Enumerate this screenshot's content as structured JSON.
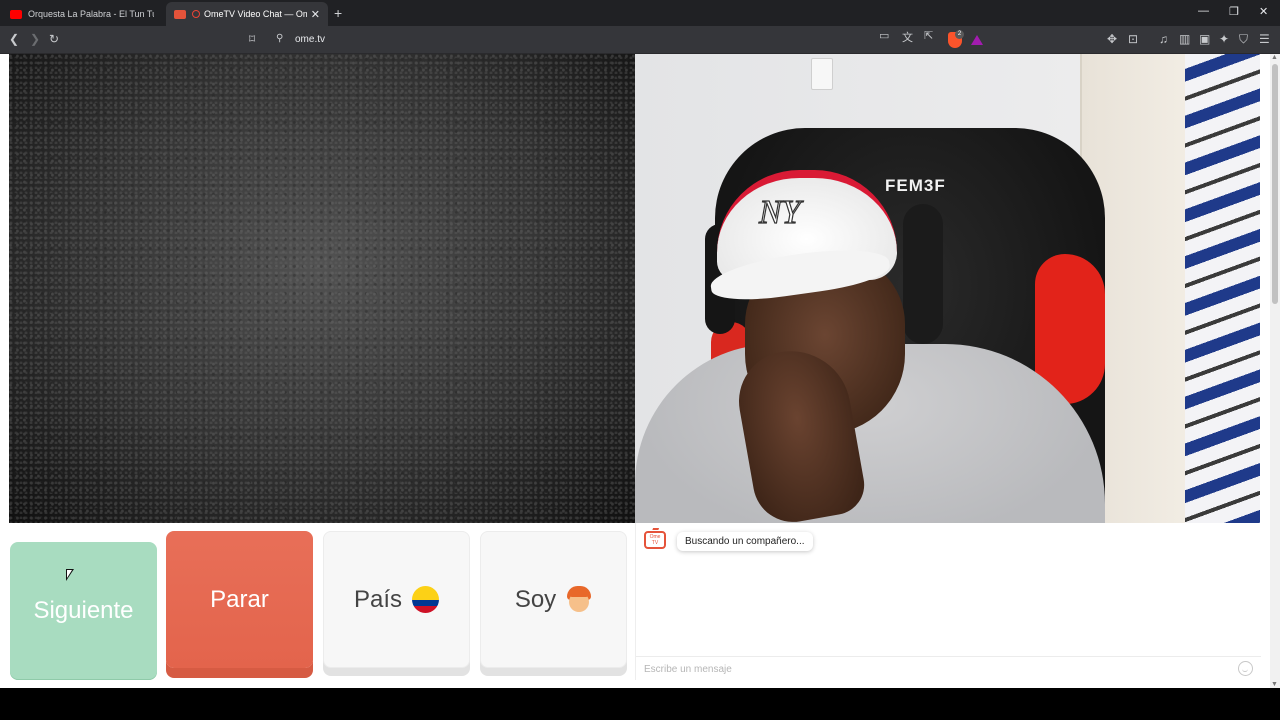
{
  "browser": {
    "tabs": [
      {
        "title": "Orquesta La Palabra - El Tun Tun De",
        "active": false
      },
      {
        "title": "OmeTV Video Chat — Omegl",
        "active": true
      }
    ],
    "new_tab_symbol": "+",
    "url": "ome.tv",
    "window_controls": {
      "minimize": "—",
      "restore": "❐",
      "close": "✕"
    },
    "shield_badge": "2"
  },
  "self_video": {
    "chair_brand": "FEM3F",
    "cap_logo": "NY"
  },
  "controls": {
    "next_label": "Siguiente",
    "stop_label": "Parar",
    "country_label": "País",
    "country_flag": "colombia-flag",
    "gender_label": "Soy",
    "gender_icon": "boy-emoji"
  },
  "chat": {
    "logo_text": "Ome TV",
    "status_message": "Buscando un compañero...",
    "input_placeholder": "Escribe un mensaje"
  },
  "colors": {
    "next_button": "#a8dcc0",
    "stop_button": "#e3644c",
    "neutral_button": "#f7f7f7",
    "brand_accent": "#e5533a"
  }
}
